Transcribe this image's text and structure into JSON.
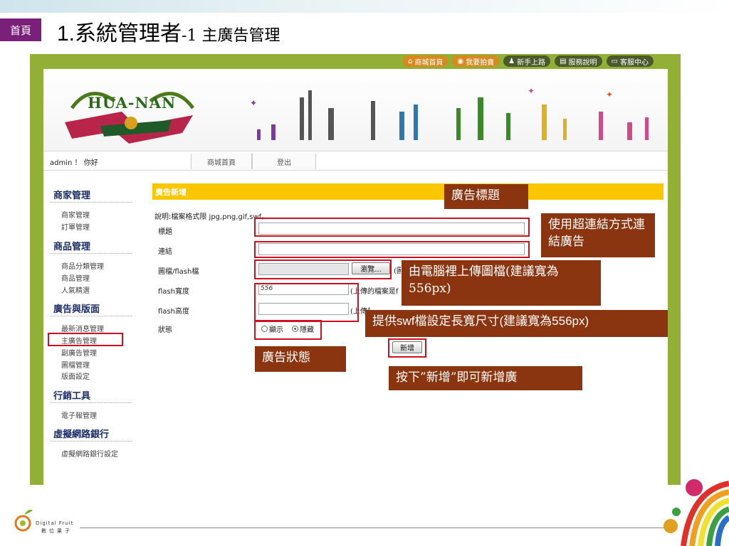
{
  "slide": {
    "home_tab": "首頁",
    "title_num": "1.",
    "title_main": "系統管理者",
    "title_sub": "-1 主廣告管理"
  },
  "topnav": [
    {
      "label": "商城首頁",
      "icon": "home-icon"
    },
    {
      "label": "我要拍賣",
      "icon": "auction-icon"
    },
    {
      "label": "新手上路",
      "icon": "user-icon"
    },
    {
      "label": "服務說明",
      "icon": "doc-icon"
    },
    {
      "label": "客服中心",
      "icon": "chat-icon"
    }
  ],
  "banner": {
    "logo_text": "HUA-NAN"
  },
  "userbar": {
    "greeting": "admin ！ 你好",
    "tabs": [
      "商城首頁",
      "登出"
    ]
  },
  "sidebar": {
    "sections": [
      {
        "title": "商家管理",
        "items": [
          "商家管理",
          "訂單管理"
        ]
      },
      {
        "title": "商品管理",
        "items": [
          "商品分類管理",
          "商品管理",
          "人氣精選"
        ]
      },
      {
        "title": "廣告與版面",
        "items": [
          "最新消息管理",
          "主廣告管理",
          "副廣告管理",
          "圖檔管理",
          "版面設定"
        ]
      },
      {
        "title": "行銷工具",
        "items": [
          "電子報管理"
        ]
      },
      {
        "title": "虛擬網路銀行",
        "items": [
          "虛擬網路銀行設定"
        ]
      }
    ]
  },
  "form": {
    "header": "廣告新增",
    "hint": "說明:檔案格式限 jpg,png,gif,swf。",
    "labels": {
      "title": "標題",
      "link": "連結",
      "file": "圖檔/flash檔",
      "flash_width": "flash寬度",
      "flash_height": "flash高度",
      "status": "狀態"
    },
    "title_value": "",
    "link_value": "",
    "file_value": "",
    "browse_label": "瀏覽...",
    "file_note": "(圖",
    "flash_width_value": "556",
    "flash_width_note": "(上傳的檔案是f",
    "flash_height_value": "",
    "flash_height_note": "(上傳的檔案是f",
    "status_options": [
      {
        "label": "顯示",
        "selected": false
      },
      {
        "label": "隱藏",
        "selected": true
      }
    ],
    "submit_label": "新增"
  },
  "callouts": {
    "ad_title": "廣告標題",
    "hyperlink": "使用超連結方式連結廣告",
    "upload": "由電腦裡上傳圖檔(建議寬為556px)",
    "swf_size": "提供swf檔設定長寬尺寸(建議寬為556px)",
    "ad_status": "廣告狀態",
    "press_add": "按下”新增”即可新增廣"
  },
  "footer": {
    "brand": "Digital Fruit",
    "brand_cn": "數位果子"
  },
  "colors": {
    "home_tab": "#7a1f7a",
    "frame_green": "#92b036",
    "form_header": "#f9c600",
    "callout_bg": "#8b3510",
    "highlight": "#d01020",
    "sidebar_heading": "#1b2d66"
  }
}
